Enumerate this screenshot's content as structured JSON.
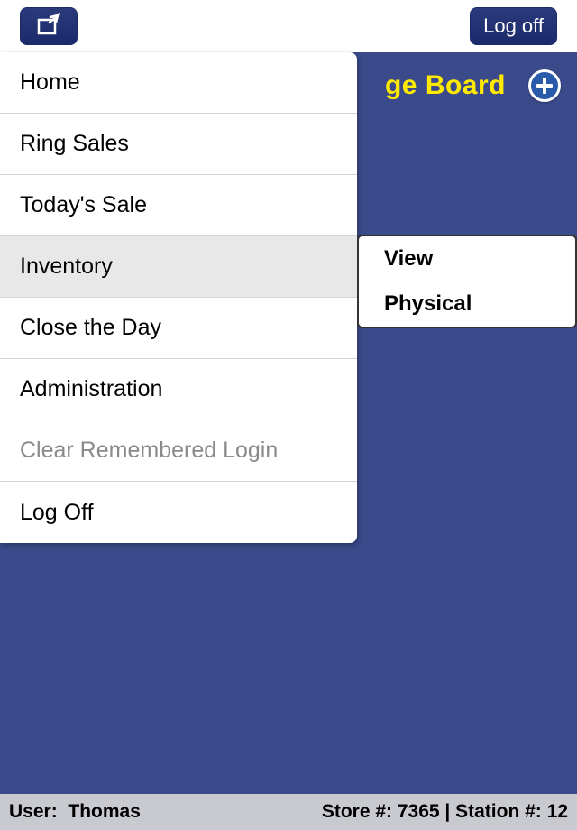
{
  "header": {
    "logoff_label": "Log off"
  },
  "page": {
    "title_visible_fragment": "ge Board"
  },
  "menu": {
    "items": [
      {
        "label": "Home",
        "state": "normal"
      },
      {
        "label": "Ring Sales",
        "state": "normal"
      },
      {
        "label": "Today's Sale",
        "state": "normal"
      },
      {
        "label": "Inventory",
        "state": "selected"
      },
      {
        "label": "Close the Day",
        "state": "normal"
      },
      {
        "label": "Administration",
        "state": "normal"
      },
      {
        "label": "Clear Remembered Login",
        "state": "disabled"
      },
      {
        "label": "Log Off",
        "state": "normal"
      }
    ]
  },
  "submenu": {
    "items": [
      {
        "label": "View"
      },
      {
        "label": "Physical"
      }
    ]
  },
  "status": {
    "user_label": "User:",
    "user_name": "Thomas",
    "store_label": "Store #:",
    "store_number": "7365",
    "station_label": "Station #:",
    "station_number": "12"
  }
}
